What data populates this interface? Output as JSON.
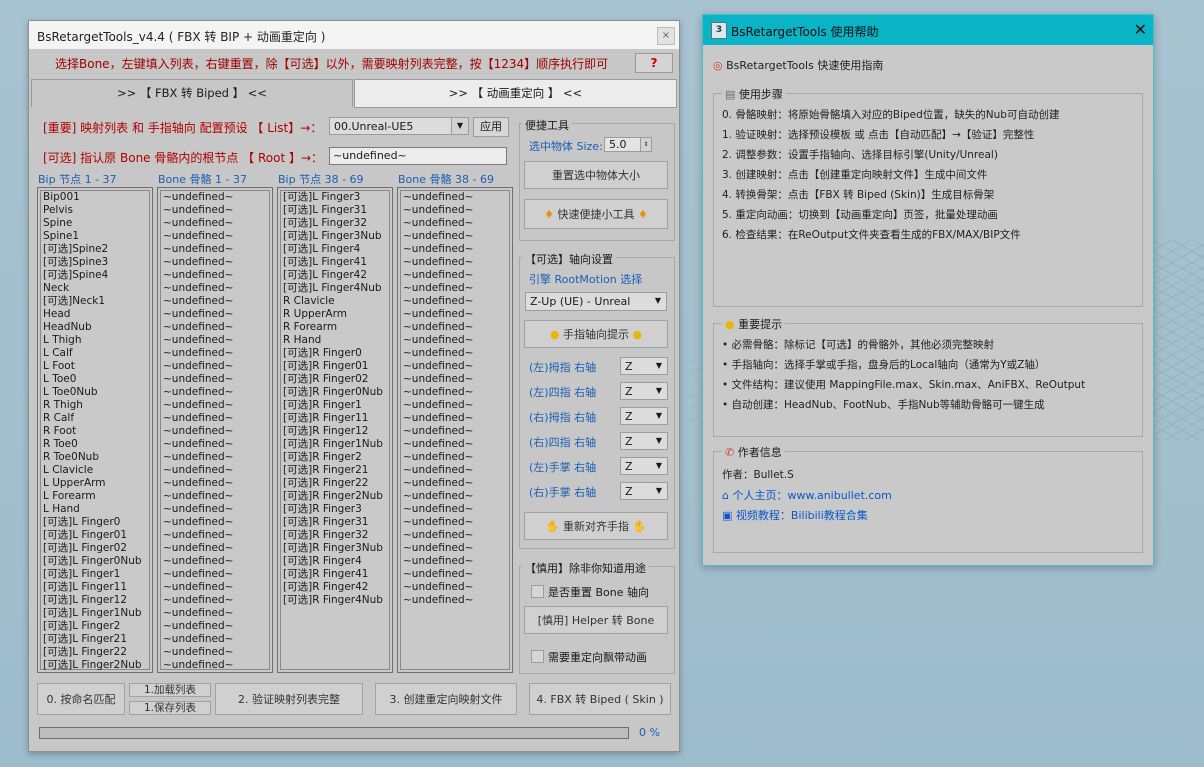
{
  "main": {
    "title": "BsRetargetTools_v4.4   ( FBX 转 BIP + 动画重定向 )",
    "close": "×",
    "instruction": "选择Bone，左键填入列表，右键重置，除【可选】以外，需要映射列表完整，按【1234】顺序执行即可",
    "help_btn": "?",
    "tabs": [
      ">> 【 FBX 转 Biped 】 <<",
      ">> 【 动画重定向 】 <<"
    ],
    "preset_label": "[重要] 映射列表 和 手指轴向 配置预设 【 List】→：",
    "preset_value": "00.Unreal-UE5",
    "apply_btn": "应用",
    "root_label": "[可选] 指认原 Bone 骨骼内的根节点 【 Root 】→：",
    "root_value": "~undefined~",
    "col_headers": [
      "Bip 节点 1 - 37",
      "Bone 骨骼 1 - 37",
      "Bip 节点 38 - 69",
      "Bone 骨骼 38 - 69"
    ],
    "bip1": [
      "Bip001",
      "Pelvis",
      "Spine",
      "Spine1",
      "[可选]Spine2",
      "[可选]Spine3",
      "[可选]Spine4",
      "Neck",
      "[可选]Neck1",
      "Head",
      "HeadNub",
      "L Thigh",
      "L Calf",
      "L Foot",
      "L Toe0",
      "L Toe0Nub",
      "R Thigh",
      "R Calf",
      "R Foot",
      "R Toe0",
      "R Toe0Nub",
      "L Clavicle",
      "L UpperArm",
      "L Forearm",
      "L Hand",
      "[可选]L Finger0",
      "[可选]L Finger01",
      "[可选]L Finger02",
      "[可选]L Finger0Nub",
      "[可选]L Finger1",
      "[可选]L Finger11",
      "[可选]L Finger12",
      "[可选]L Finger1Nub",
      "[可选]L Finger2",
      "[可选]L Finger21",
      "[可选]L Finger22",
      "[可选]L Finger2Nub"
    ],
    "bip2": [
      "[可选]L Finger3",
      "[可选]L Finger31",
      "[可选]L Finger32",
      "[可选]L Finger3Nub",
      "[可选]L Finger4",
      "[可选]L Finger41",
      "[可选]L Finger42",
      "[可选]L Finger4Nub",
      "R Clavicle",
      "R UpperArm",
      "R Forearm",
      "R Hand",
      "[可选]R Finger0",
      "[可选]R Finger01",
      "[可选]R Finger02",
      "[可选]R Finger0Nub",
      "[可选]R Finger1",
      "[可选]R Finger11",
      "[可选]R Finger12",
      "[可选]R Finger1Nub",
      "[可选]R Finger2",
      "[可选]R Finger21",
      "[可选]R Finger22",
      "[可选]R Finger2Nub",
      "[可选]R Finger3",
      "[可选]R Finger31",
      "[可选]R Finger32",
      "[可选]R Finger3Nub",
      "[可选]R Finger4",
      "[可选]R Finger41",
      "[可选]R Finger42",
      "[可选]R Finger4Nub"
    ],
    "undefined_item": "~undefined~",
    "bone1_count": 37,
    "bone2_count": 32,
    "quick_tools": {
      "title": "便捷工具",
      "size_label": "选中物体 Size:",
      "size_value": "5.0",
      "reset_size_btn": "重置选中物体大小",
      "quick_btn": "快速便捷小工具"
    },
    "axis": {
      "title": "【可选】轴向设置",
      "engine_label": "引擎 RootMotion 选择",
      "engine_value": "Z-Up (UE)   -  Unreal",
      "finger_axis_btn": "手指轴向提示",
      "rows": [
        {
          "label": "(左)拇指 右轴",
          "value": "Z"
        },
        {
          "label": "(左)四指 右轴",
          "value": "Z"
        },
        {
          "label": "(右)拇指 右轴",
          "value": "Z"
        },
        {
          "label": "(右)四指 右轴",
          "value": "Z"
        },
        {
          "label": "(左)手掌 右轴",
          "value": "Z"
        },
        {
          "label": "(右)手掌 右轴",
          "value": "Z"
        }
      ],
      "realign_btn": "重新对齐手指"
    },
    "caution": {
      "title": "【慎用】除非你知道用途",
      "reset_bone_axis": "是否重置 Bone 轴向",
      "helper_btn": "[慎用] Helper 转 Bone",
      "retarget_float": "需要重定向飘带动画"
    },
    "bottom": {
      "match_btn": "0. 按命名匹配",
      "load_btn": "1.加载列表",
      "save_btn": "1.保存列表",
      "verify_btn": "2. 验证映射列表完整",
      "create_btn": "3. 创建重定向映射文件",
      "convert_btn": "4. FBX 转 Biped ( Skin )",
      "progress": 0,
      "progress_label": "0 %"
    }
  },
  "help": {
    "title": "BsRetargetTools 使用帮助",
    "close": "✕",
    "subtitle": "BsRetargetTools 快速使用指南",
    "steps_title": "使用步骤",
    "steps": [
      "0. 骨骼映射：将原始骨骼填入对应的Biped位置，缺失的Nub可自动创建",
      "1. 验证映射：选择预设模板 或 点击【自动匹配】→【验证】完整性",
      "2. 调整参数：设置手指轴向、选择目标引擎(Unity/Unreal)",
      "3. 创建映射：点击【创建重定向映射文件】生成中间文件",
      "4. 转换骨架：点击【FBX 转 Biped (Skin)】生成目标骨架",
      "5. 重定向动画：切换到【动画重定向】页签，批量处理动画",
      "6. 检查结果：在ReOutput文件夹查看生成的FBX/MAX/BIP文件"
    ],
    "tips_title": "重要提示",
    "tips": [
      "• 必需骨骼：除标记【可选】的骨骼外，其他必须完整映射",
      "• 手指轴向：选择手掌或手指，盘身后的Local轴向（通常为Y或Z轴）",
      "• 文件结构：建议使用 MappingFile.max、Skin.max、AniFBX、ReOutput",
      "• 自动创建：HeadNub、FootNub、手指Nub等辅助骨骼可一键生成"
    ],
    "author_title": "作者信息",
    "author": "作者：Bullet.S",
    "homepage": "个人主页：www.anibullet.com",
    "video": "视频教程：Bilibili教程合集"
  }
}
